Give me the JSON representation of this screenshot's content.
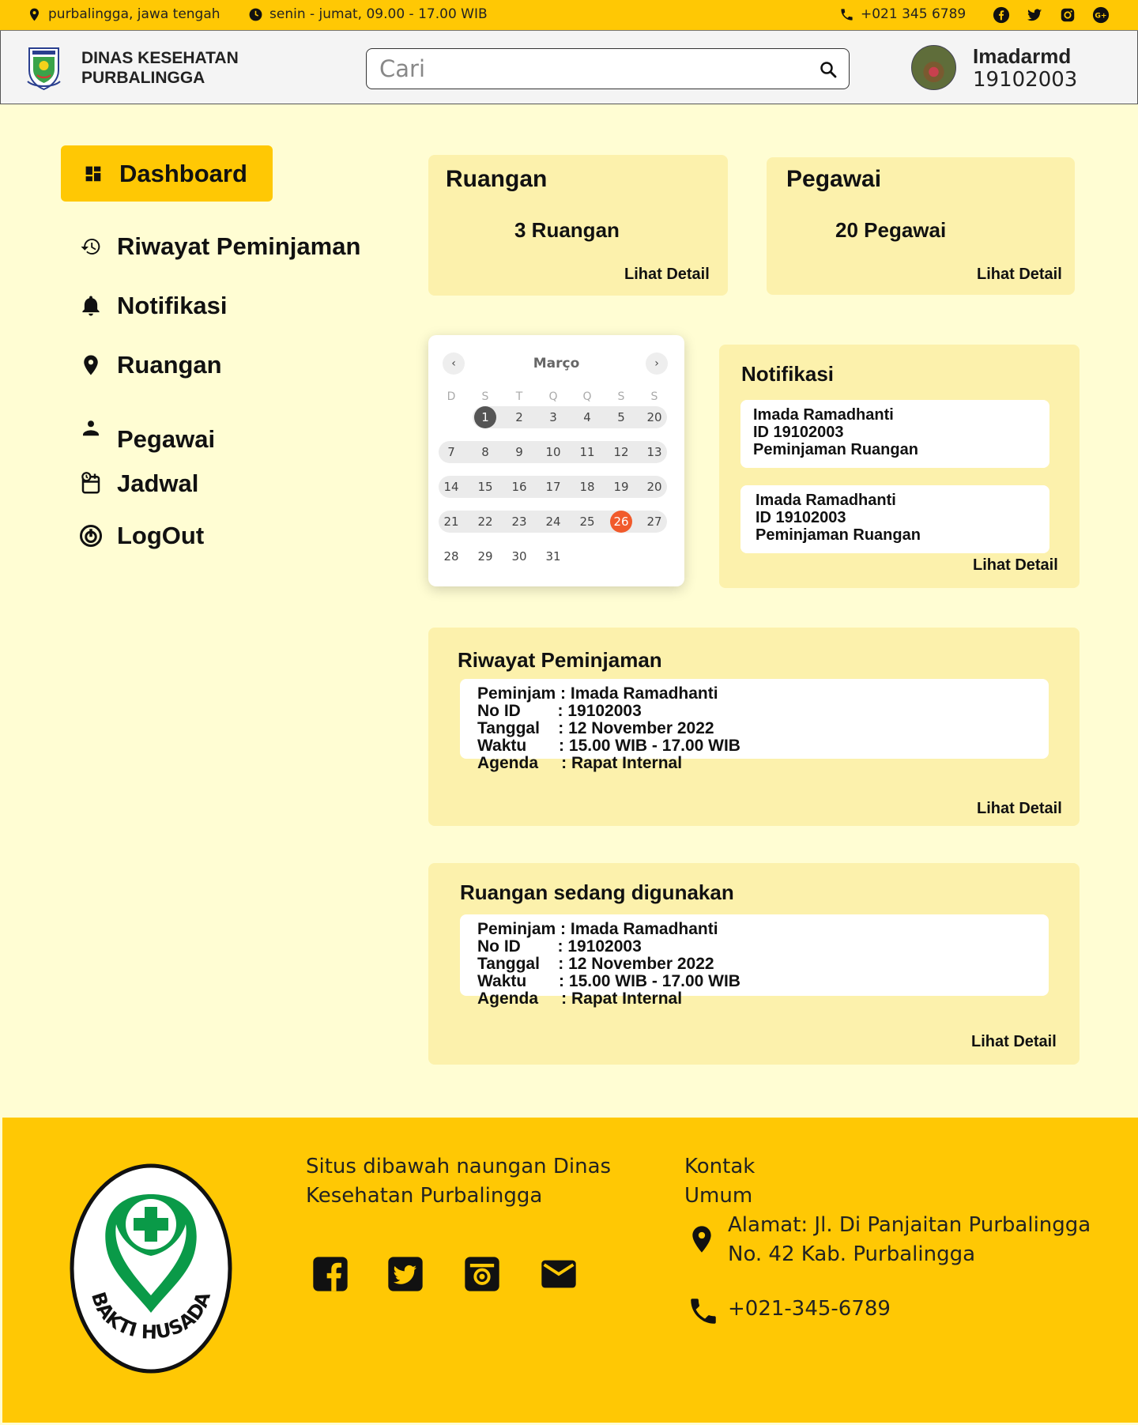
{
  "topbar": {
    "location": "purbalingga,  jawa tengah",
    "hours": "senin - jumat, 09.00 - 17.00 WIB",
    "phone": "+021 345 6789",
    "socials": [
      "facebook-icon",
      "twitter-icon",
      "instagram-icon",
      "google-plus-icon"
    ]
  },
  "header": {
    "brand_line1": "DINAS KESEHATAN",
    "brand_line2": "PURBALINGGA",
    "search_placeholder": "Cari",
    "user_name": "Imadarmd",
    "user_id": "19102003"
  },
  "sidebar": {
    "items": [
      {
        "label": "Dashboard",
        "icon": "dashboard-icon"
      },
      {
        "label": "Riwayat Peminjaman",
        "icon": "history-icon"
      },
      {
        "label": "Notifikasi",
        "icon": "bell-icon"
      },
      {
        "label": "Ruangan",
        "icon": "location-pin-icon"
      },
      {
        "label": "Pegawai",
        "icon": "person-icon"
      },
      {
        "label": "Jadwal",
        "icon": "schedule-icon"
      },
      {
        "label": "LogOut",
        "icon": "power-icon"
      }
    ]
  },
  "cards": {
    "ruangan": {
      "title": "Ruangan",
      "value": "3 Ruangan",
      "link": "Lihat Detail"
    },
    "pegawai": {
      "title": "Pegawai",
      "value": "20 Pegawai",
      "link": "Lihat Detail"
    }
  },
  "calendar": {
    "month": "Março",
    "weekdays": [
      "D",
      "S",
      "T",
      "Q",
      "Q",
      "S",
      "S"
    ],
    "weeks": [
      [
        "",
        "1",
        "2",
        "3",
        "4",
        "5",
        "20"
      ],
      [
        "7",
        "8",
        "9",
        "10",
        "11",
        "12",
        "13"
      ],
      [
        "14",
        "15",
        "16",
        "17",
        "18",
        "19",
        "20"
      ],
      [
        "21",
        "22",
        "23",
        "24",
        "25",
        "26",
        "27"
      ],
      [
        "28",
        "29",
        "30",
        "31",
        "",
        "",
        ""
      ]
    ],
    "today": "1",
    "selected": "26"
  },
  "notifikasi": {
    "title": "Notifikasi",
    "items": [
      {
        "name": "Imada Ramadhanti",
        "id": "ID 19102003",
        "type": "Peminjaman Ruangan"
      },
      {
        "name": "Imada Ramadhanti",
        "id": "ID 19102003",
        "type": "Peminjaman Ruangan"
      }
    ],
    "link": "Lihat Detail"
  },
  "riwayat": {
    "title": "Riwayat Peminjaman",
    "lines": [
      "Peminjam : Imada Ramadhanti",
      "No ID        : 19102003",
      "Tanggal    : 12 November 2022",
      "Waktu       : 15.00 WIB - 17.00 WIB",
      "Agenda     : Rapat Internal"
    ],
    "link": "Lihat Detail"
  },
  "ruangan_digunakan": {
    "title": "Ruangan sedang digunakan",
    "lines": [
      "Peminjam : Imada Ramadhanti",
      "No ID        : 19102003",
      "Tanggal    : 12 November 2022",
      "Waktu       : 15.00 WIB - 17.00 WIB",
      "Agenda     : Rapat Internal"
    ],
    "link": "Lihat Detail"
  },
  "footer": {
    "about_line1": "Situs dibawah naungan Dinas",
    "about_line2": "Kesehatan Purbalingga",
    "contact_title1": "Kontak",
    "contact_title2": "Umum",
    "address_line1": "Alamat: Jl. Di Panjaitan Purbalingga",
    "address_line2": "No. 42 Kab. Purbalingga",
    "phone": "+021-345-6789",
    "logo_text": "BAKTI HUSADA",
    "socials": [
      "facebook-icon",
      "twitter-icon",
      "instagram-icon",
      "mail-icon"
    ]
  },
  "colors": {
    "accent": "#ffc804",
    "page_bg": "#fffdd3",
    "card_bg": "#fcf1ac",
    "selected_day": "#f15a2b",
    "logo_green": "#0a9a48"
  }
}
